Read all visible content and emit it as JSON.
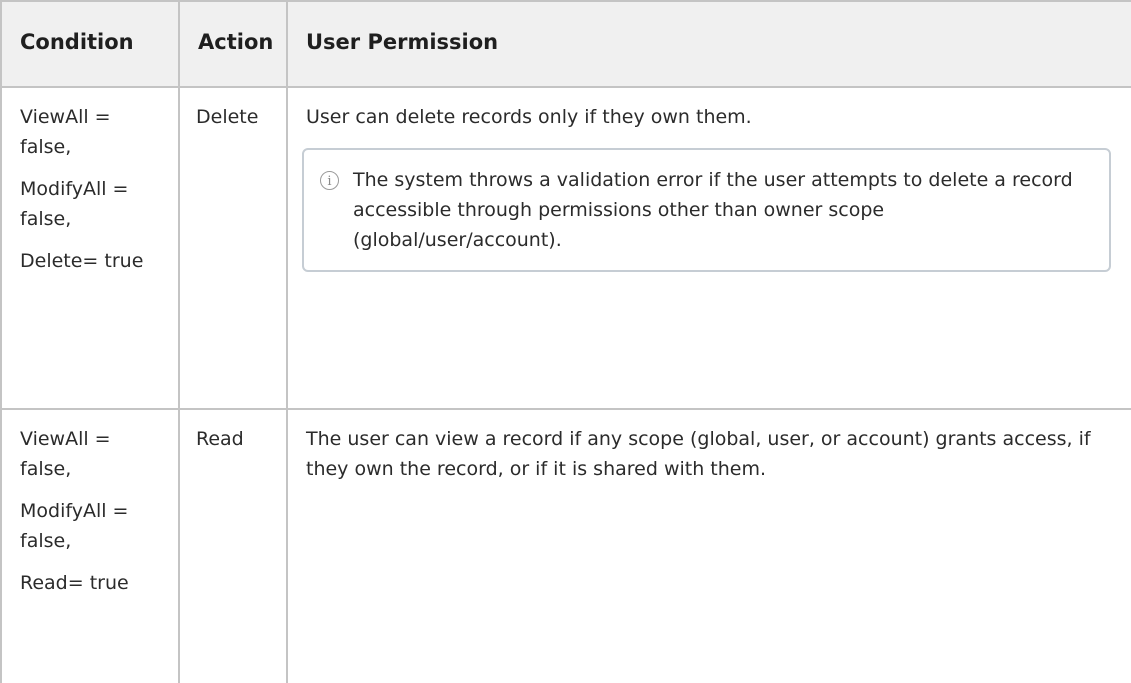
{
  "table": {
    "headers": [
      "Condition",
      "Action",
      "User Permission"
    ],
    "rows": [
      {
        "condition": [
          "ViewAll = false,",
          "ModifyAll = false,",
          "Delete= true"
        ],
        "action": "Delete",
        "permission": "User can delete records only if they own them.",
        "note": {
          "icon": "info-icon",
          "text": "The system throws a validation error if the user attempts to delete a record accessible through permissions other than owner scope (global/user/account)."
        }
      },
      {
        "condition": [
          "ViewAll = false,",
          "ModifyAll = false,",
          "Read= true"
        ],
        "action": "Read",
        "permission": "The user can view a record if any scope (global, user, or account) grants access, if they own the record, or if it is shared with them."
      }
    ]
  }
}
